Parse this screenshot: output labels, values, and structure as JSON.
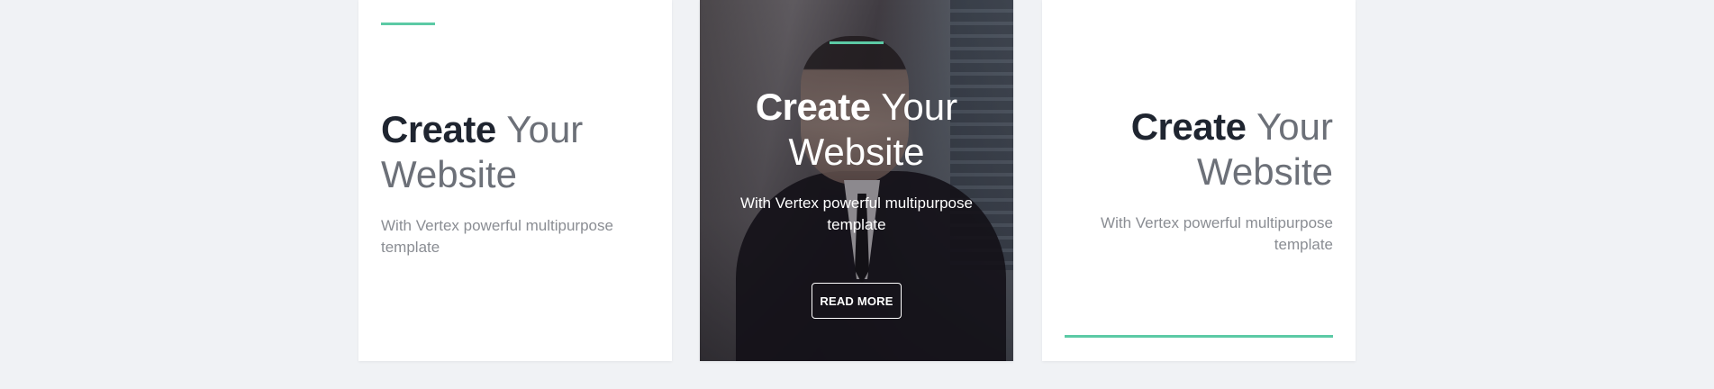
{
  "cards": [
    {
      "title_bold": "Create",
      "title_light": "Your Website",
      "subtitle": "With Vertex powerful multipurpose template"
    },
    {
      "title_bold": "Create",
      "title_light": "Your Website",
      "subtitle": "With Vertex powerful multipurpose template",
      "button_label": "READ MORE"
    },
    {
      "title_bold": "Create",
      "title_light": "Your Website",
      "subtitle": "With Vertex powerful multipurpose template"
    }
  ],
  "colors": {
    "accent": "#5ccaa5",
    "page_background": "#f0f2f5",
    "card_background": "#ffffff",
    "heading_dark": "#1f2530",
    "subtitle_gray": "#8a8d93"
  }
}
